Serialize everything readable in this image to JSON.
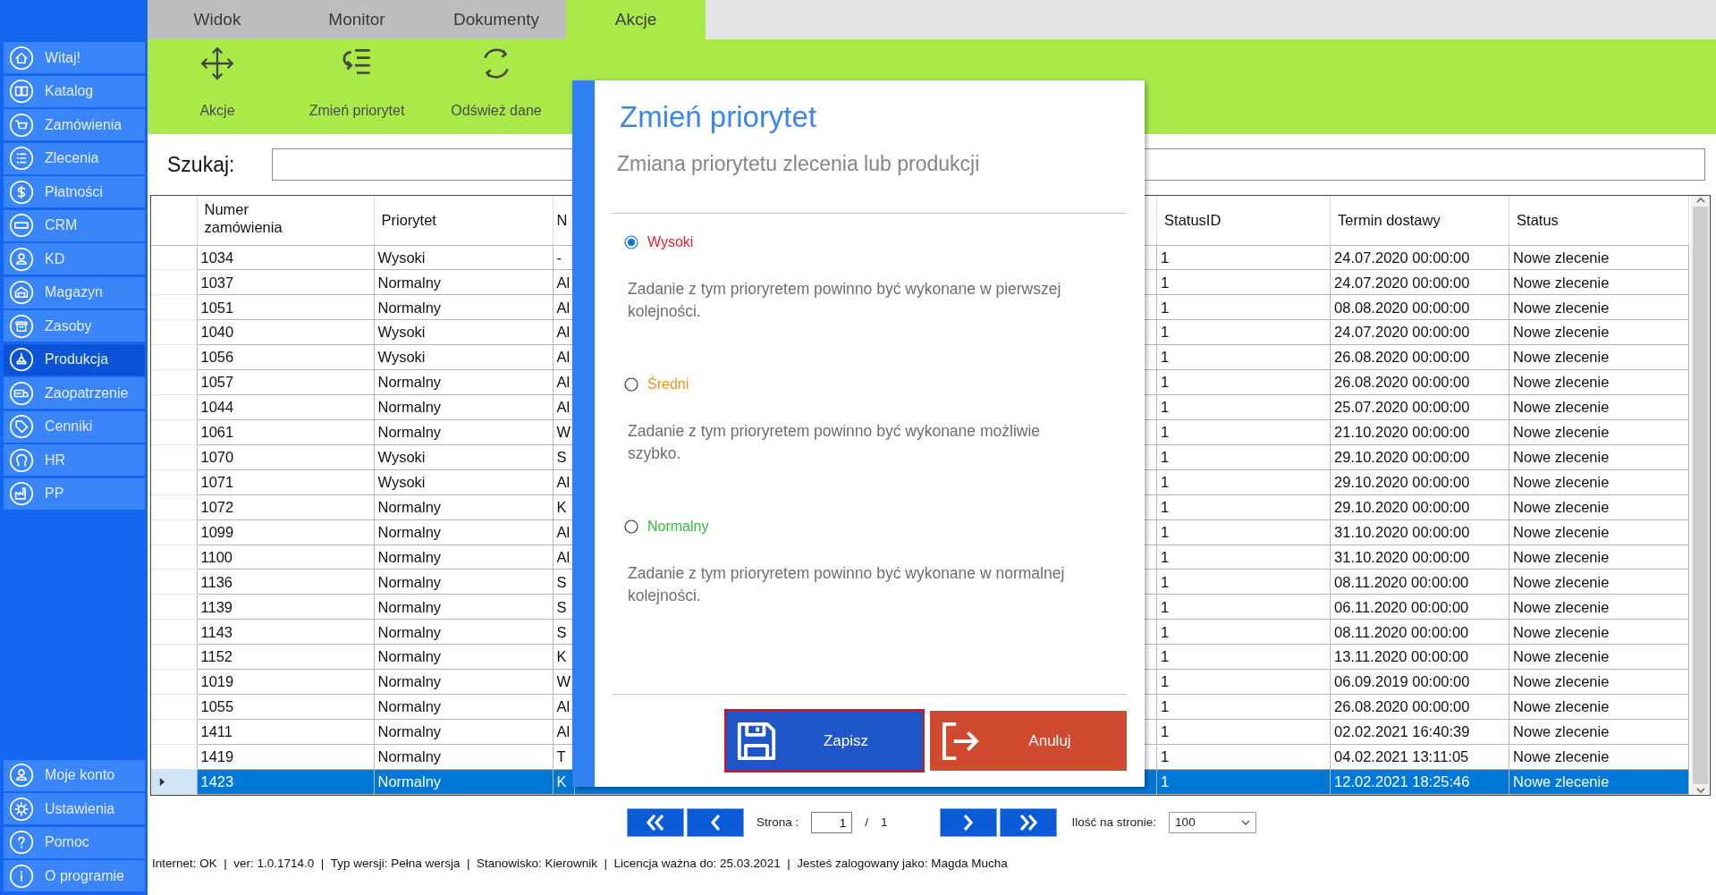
{
  "sidebar": {
    "items": [
      {
        "label": "Witaj!",
        "selected": false
      },
      {
        "label": "Katalog",
        "selected": false
      },
      {
        "label": "Zamówienia",
        "selected": false
      },
      {
        "label": "Zlecenia",
        "selected": false
      },
      {
        "label": "Płatności",
        "selected": false
      },
      {
        "label": "CRM",
        "selected": false
      },
      {
        "label": "KD",
        "selected": false
      },
      {
        "label": "Magazyn",
        "selected": false
      },
      {
        "label": "Zasoby",
        "selected": false
      },
      {
        "label": "Produkcja",
        "selected": true
      },
      {
        "label": "Zaopatrzenie",
        "selected": false
      },
      {
        "label": "Cenniki",
        "selected": false
      },
      {
        "label": "HR",
        "selected": false
      },
      {
        "label": "PP",
        "selected": false
      }
    ],
    "bottom_items": [
      {
        "label": "Moje konto"
      },
      {
        "label": "Ustawienia"
      },
      {
        "label": "Pomoc"
      },
      {
        "label": "O programie"
      }
    ]
  },
  "ribbon_tabs": [
    {
      "label": "Widok",
      "selected": false
    },
    {
      "label": "Monitor",
      "selected": false
    },
    {
      "label": "Dokumenty",
      "selected": false
    },
    {
      "label": "Akcje",
      "selected": true
    }
  ],
  "ribbon_buttons": [
    {
      "label": "Akcje"
    },
    {
      "label": "Zmień priorytet"
    },
    {
      "label": "Odśwież dane"
    }
  ],
  "search": {
    "label": "Szukaj:"
  },
  "table": {
    "columns": [
      "Numer zamówienia",
      "Priorytet",
      "N",
      "StatusID",
      "Termin dostawy",
      "Status"
    ],
    "rows": [
      {
        "cells": [
          "1034",
          "Wysoki",
          "-",
          "1",
          "24.07.2020 00:00:00",
          "Nowe zlecenie"
        ],
        "selected": false
      },
      {
        "cells": [
          "1037",
          "Normalny",
          "Al",
          "1",
          "24.07.2020 00:00:00",
          "Nowe zlecenie"
        ],
        "selected": false
      },
      {
        "cells": [
          "1051",
          "Normalny",
          "Al",
          "1",
          "08.08.2020 00:00:00",
          "Nowe zlecenie"
        ],
        "selected": false
      },
      {
        "cells": [
          "1040",
          "Wysoki",
          "Al",
          "1",
          "24.07.2020 00:00:00",
          "Nowe zlecenie"
        ],
        "selected": false
      },
      {
        "cells": [
          "1056",
          "Wysoki",
          "Al",
          "1",
          "26.08.2020 00:00:00",
          "Nowe zlecenie"
        ],
        "selected": false
      },
      {
        "cells": [
          "1057",
          "Normalny",
          "Al",
          "1",
          "26.08.2020 00:00:00",
          "Nowe zlecenie"
        ],
        "selected": false
      },
      {
        "cells": [
          "1044",
          "Normalny",
          "Al",
          "1",
          "25.07.2020 00:00:00",
          "Nowe zlecenie"
        ],
        "selected": false
      },
      {
        "cells": [
          "1061",
          "Normalny",
          "W",
          "1",
          "21.10.2020 00:00:00",
          "Nowe zlecenie"
        ],
        "selected": false
      },
      {
        "cells": [
          "1070",
          "Wysoki",
          "S",
          "1",
          "29.10.2020 00:00:00",
          "Nowe zlecenie"
        ],
        "selected": false
      },
      {
        "cells": [
          "1071",
          "Wysoki",
          "Al",
          "1",
          "29.10.2020 00:00:00",
          "Nowe zlecenie"
        ],
        "selected": false
      },
      {
        "cells": [
          "1072",
          "Normalny",
          "K",
          "1",
          "29.10.2020 00:00:00",
          "Nowe zlecenie"
        ],
        "selected": false
      },
      {
        "cells": [
          "1099",
          "Normalny",
          "Al",
          "1",
          "31.10.2020 00:00:00",
          "Nowe zlecenie"
        ],
        "selected": false
      },
      {
        "cells": [
          "1100",
          "Normalny",
          "Al",
          "1",
          "31.10.2020 00:00:00",
          "Nowe zlecenie"
        ],
        "selected": false
      },
      {
        "cells": [
          "1136",
          "Normalny",
          "S",
          "1",
          "08.11.2020 00:00:00",
          "Nowe zlecenie"
        ],
        "selected": false
      },
      {
        "cells": [
          "1139",
          "Normalny",
          "S",
          "1",
          "06.11.2020 00:00:00",
          "Nowe zlecenie"
        ],
        "selected": false
      },
      {
        "cells": [
          "1143",
          "Normalny",
          "S",
          "1",
          "08.11.2020 00:00:00",
          "Nowe zlecenie"
        ],
        "selected": false
      },
      {
        "cells": [
          "1152",
          "Normalny",
          "K",
          "1",
          "13.11.2020 00:00:00",
          "Nowe zlecenie"
        ],
        "selected": false
      },
      {
        "cells": [
          "1019",
          "Normalny",
          "W",
          "1",
          "06.09.2019 00:00:00",
          "Nowe zlecenie"
        ],
        "selected": false
      },
      {
        "cells": [
          "1055",
          "Normalny",
          "Al",
          "1",
          "26.08.2020 00:00:00",
          "Nowe zlecenie"
        ],
        "selected": false
      },
      {
        "cells": [
          "1411",
          "Normalny",
          "Al",
          "1",
          "02.02.2021 16:40:39",
          "Nowe zlecenie"
        ],
        "selected": false
      },
      {
        "cells": [
          "1419",
          "Normalny",
          "T",
          "1",
          "04.02.2021 13:11:05",
          "Nowe zlecenie"
        ],
        "selected": false
      },
      {
        "cells": [
          "1423",
          "Normalny",
          "K",
          "1",
          "12.02.2021 18:25:46",
          "Nowe zlecenie"
        ],
        "selected": true
      }
    ]
  },
  "dialog": {
    "title": "Zmień priorytet",
    "subtitle": "Zmiana priorytetu zlecenia lub produkcji",
    "options": [
      {
        "label": "Wysoki",
        "color": "#e8232b",
        "selected": true,
        "description": "Zadanie z tym prioryretem powinno być wykonane w pierwszej kolejności."
      },
      {
        "label": "Średni",
        "color": "#f0901e",
        "selected": false,
        "description": "Zadanie z tym prioryretem powinno być wykonane możliwie szybko."
      },
      {
        "label": "Normalny",
        "color": "#2cbf3a",
        "selected": false,
        "description": "Zadanie z tym prioryretem powinno być wykonane w normalnej kolejności."
      }
    ],
    "buttons": [
      {
        "label": "Zapisz",
        "kind": "save"
      },
      {
        "label": "Anuluj",
        "kind": "cancel"
      }
    ]
  },
  "pager": {
    "page_label": "Strona :",
    "page": "1",
    "separator": "/",
    "total": "1",
    "per_page_label": "Ilość na stronie:",
    "per_page": "100"
  },
  "status_bar": "Internet: OK  |  ver: 1.0.1714.0  |  Typ wersji: Pełna wersja  |  Stanowisko: Kierownik  |  Licencja ważna do: 25.03.2021  |  Jesteś zalogowany jako: Magda Mucha"
}
